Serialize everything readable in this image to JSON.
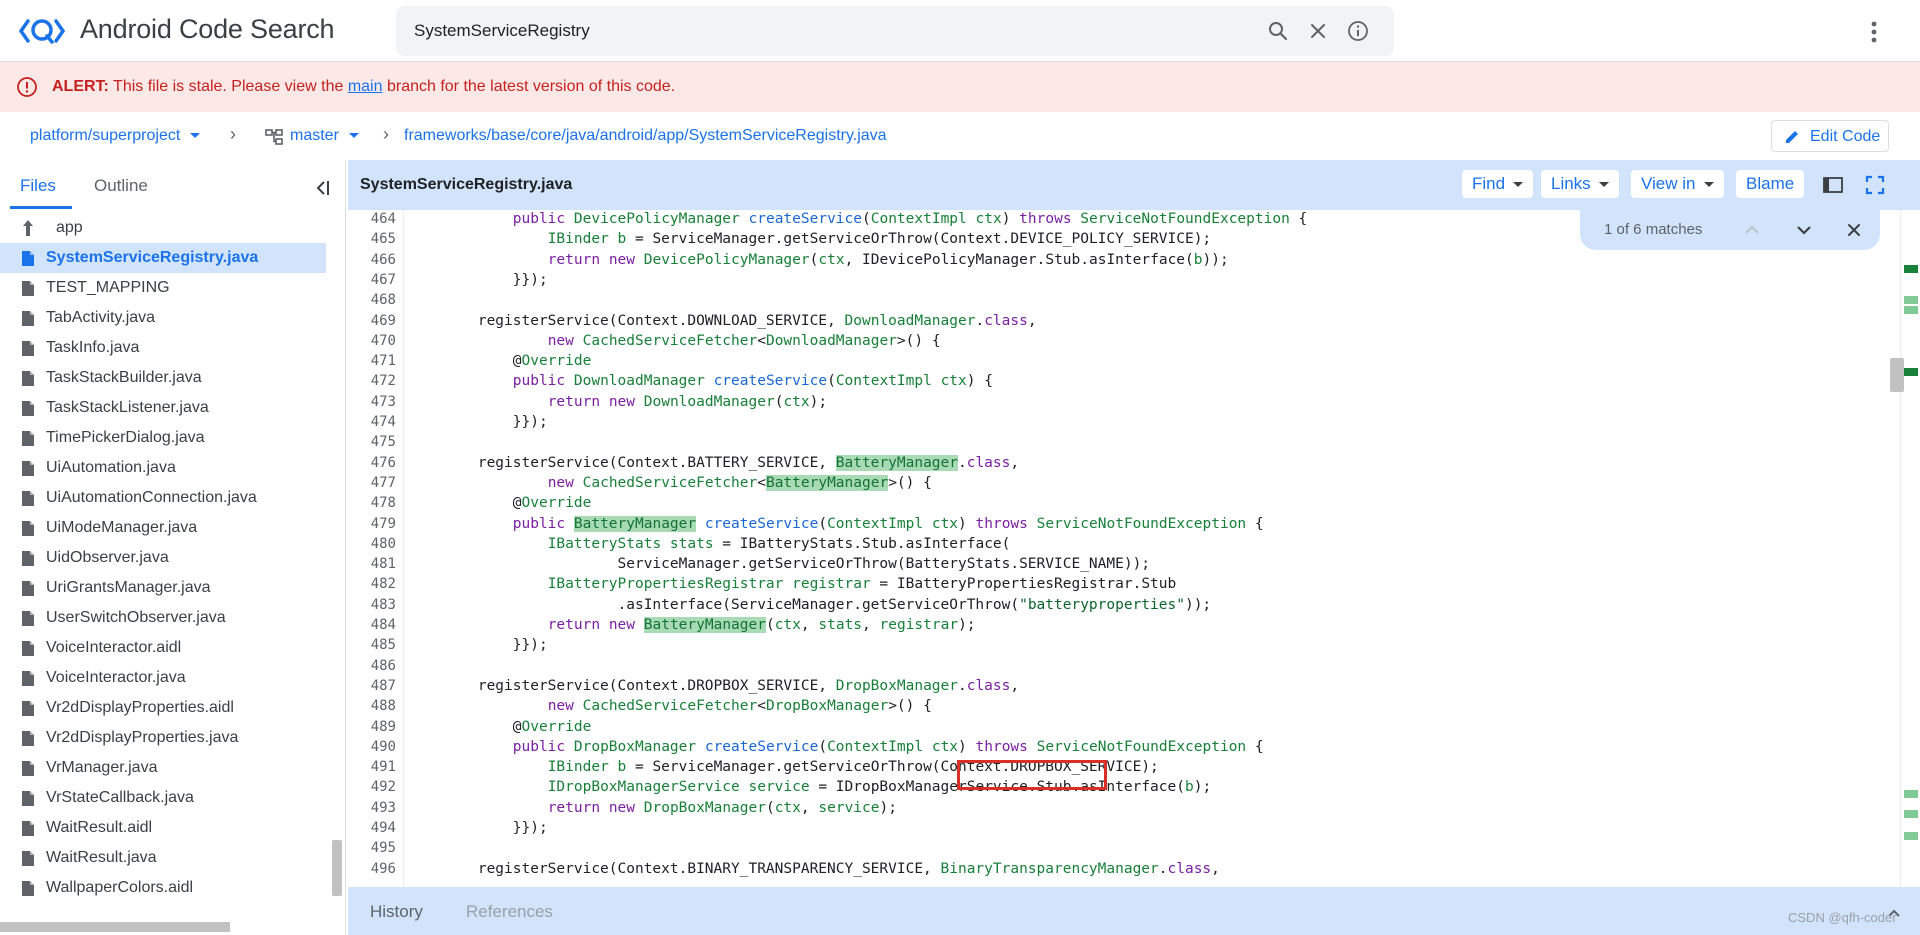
{
  "header": {
    "title": "Android Code Search",
    "search_value": "SystemServiceRegistry"
  },
  "alert": {
    "label": "ALERT:",
    "text_before": "This file is stale. Please view the",
    "link": "main",
    "text_after": "branch for the latest version of this code."
  },
  "breadcrumb": {
    "project": "platform/superproject",
    "branch": "master",
    "path": "frameworks/base/core/java/android/app/SystemServiceRegistry.java",
    "edit_label": "Edit Code"
  },
  "sidebar": {
    "tabs": [
      "Files",
      "Outline"
    ],
    "up_label": "app",
    "files": [
      "SystemServiceRegistry.java",
      "TEST_MAPPING",
      "TabActivity.java",
      "TaskInfo.java",
      "TaskStackBuilder.java",
      "TaskStackListener.java",
      "TimePickerDialog.java",
      "UiAutomation.java",
      "UiAutomationConnection.java",
      "UiModeManager.java",
      "UidObserver.java",
      "UriGrantsManager.java",
      "UserSwitchObserver.java",
      "VoiceInteractor.aidl",
      "VoiceInteractor.java",
      "Vr2dDisplayProperties.aidl",
      "Vr2dDisplayProperties.java",
      "VrManager.java",
      "VrStateCallback.java",
      "WaitResult.aidl",
      "WaitResult.java",
      "WallpaperColors.aidl"
    ]
  },
  "code_header": {
    "filename": "SystemServiceRegistry.java",
    "find": "Find",
    "links": "Links",
    "view_in": "View in",
    "blame": "Blame"
  },
  "find_bar": {
    "status": "1 of 6 matches"
  },
  "code": {
    "line_numbers": [
      "464",
      "465",
      "466",
      "467",
      "468",
      "469",
      "470",
      "471",
      "472",
      "473",
      "474",
      "475",
      "476",
      "477",
      "478",
      "479",
      "480",
      "481",
      "482",
      "483",
      "484",
      "485",
      "486",
      "487",
      "488",
      "489",
      "490",
      "491",
      "492",
      "493",
      "494",
      "495",
      "496"
    ]
  },
  "bottom": {
    "history": "History",
    "references": "References",
    "watermark": "CSDN @qfh-coder"
  }
}
